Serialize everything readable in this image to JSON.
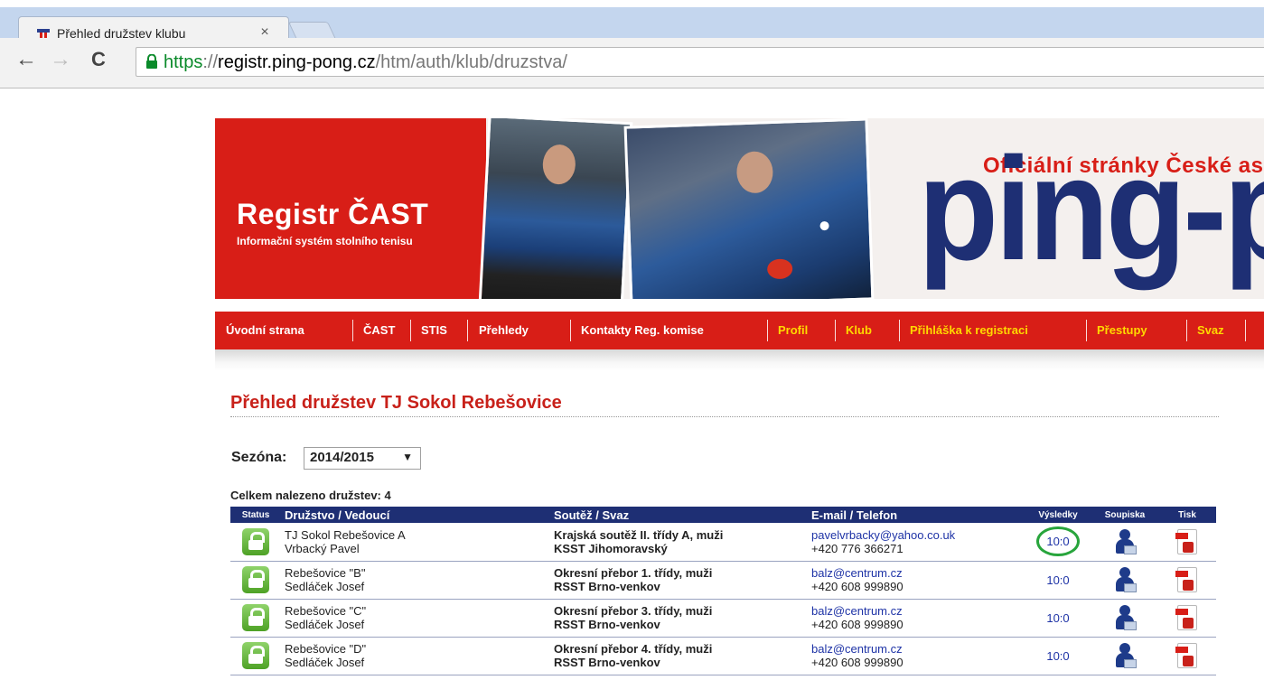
{
  "browser": {
    "tab_title": "Přehled družstev klubu",
    "tab_close": "×",
    "url_scheme": "https",
    "url_sep": "://",
    "url_host": "registr.ping-pong.cz",
    "url_path": "/htm/auth/klub/druzstva/",
    "back": "←",
    "forward": "→",
    "reload": "C"
  },
  "banner": {
    "brand_title": "Registr ČAST",
    "brand_subtitle": "Informační systém stolního tenisu",
    "official": "Oficiální stránky České asoc",
    "bigword": "ping-pon"
  },
  "nav": {
    "items": [
      {
        "label": "Úvodní strana"
      },
      {
        "label": "ČAST"
      },
      {
        "label": "STIS"
      },
      {
        "label": "Přehledy"
      },
      {
        "label": "Kontakty Reg. komise"
      },
      {
        "label": "Profil"
      },
      {
        "label": "Klub"
      },
      {
        "label": "Přihláška k registraci"
      },
      {
        "label": "Přestupy"
      },
      {
        "label": "Svaz"
      }
    ]
  },
  "page": {
    "title": "Přehled družstev TJ Sokol Rebešovice",
    "season_label": "Sezóna:",
    "season_value": "2014/2015",
    "season_arrow": "▼",
    "count_text": "Celkem nalezeno družstev: 4"
  },
  "table": {
    "headers": {
      "status": "Status",
      "team": "Družstvo / Vedoucí",
      "league": "Soutěž / Svaz",
      "contact": "E-mail / Telefon",
      "results": "Výsledky",
      "roster": "Soupiska",
      "print": "Tisk"
    },
    "rows": [
      {
        "team": "TJ Sokol Rebešovice A",
        "leader": "Vrbacký Pavel",
        "league": "Krajská soutěž II. třídy A, muži",
        "union": "KSST Jihomoravský",
        "email": "pavelvrbacky@yahoo.co.uk",
        "phone": "+420 776 366271",
        "result": "10:0"
      },
      {
        "team": "Rebešovice \"B\"",
        "leader": "Sedláček Josef",
        "league": "Okresní přebor 1. třídy, muži",
        "union": "RSST Brno-venkov",
        "email": "balz@centrum.cz",
        "phone": "+420 608 999890",
        "result": "10:0"
      },
      {
        "team": "Rebešovice \"C\"",
        "leader": "Sedláček Josef",
        "league": "Okresní přebor 3. třídy, muži",
        "union": "RSST Brno-venkov",
        "email": "balz@centrum.cz",
        "phone": "+420 608 999890",
        "result": "10:0"
      },
      {
        "team": "Rebešovice \"D\"",
        "leader": "Sedláček Josef",
        "league": "Okresní přebor 4. třídy, muži",
        "union": "RSST Brno-venkov",
        "email": "balz@centrum.cz",
        "phone": "+420 608 999890",
        "result": "10:0"
      }
    ]
  },
  "colors": {
    "brand_red": "#d81e17",
    "nav_yellow": "#ffd800",
    "header_navy": "#1e2f74",
    "highlight_green": "#28a53c"
  }
}
